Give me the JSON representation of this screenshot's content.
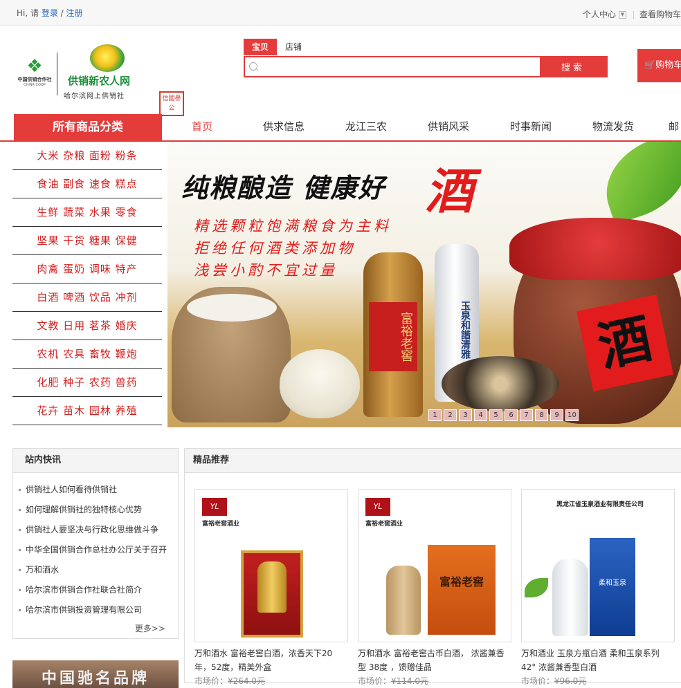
{
  "topbar": {
    "greeting": "Hi, 请",
    "login": "登录",
    "slash": "/",
    "register": "注册",
    "account": "个人中心",
    "view_cart": "查看购物车"
  },
  "logo": {
    "coop_cn": "中国供销合作社",
    "coop_en": "CHINA COOP",
    "brand": "供销新农人网",
    "brand_sub": "哈尔滨网上供销社",
    "stamp": "信國譽公"
  },
  "search": {
    "tab_active": "宝贝",
    "tab_other": "店铺",
    "placeholder": "",
    "button": "搜索"
  },
  "cart": {
    "label": "购物车"
  },
  "nav": {
    "all_categories": "所有商品分类",
    "items": [
      "首页",
      "供求信息",
      "龙江三农",
      "供销风采",
      "时事新闻",
      "物流发货",
      "邮"
    ]
  },
  "categories": [
    "大米 杂粮 面粉 粉条",
    "食油 副食 速食 糕点",
    "生鲜 蔬菜 水果 零食",
    "坚果 干货 糖果 保健",
    "肉禽 蛋奶 调味 特产",
    "白酒 啤酒 饮品 冲剂",
    "文教 日用 茗茶 婚庆",
    "农机 农具 畜牧 鞭炮",
    "化肥 种子 农药 兽药",
    "花卉 苗木 园林 养殖"
  ],
  "banner": {
    "headline": "纯粮酿造 健康好",
    "headline_big": "酒",
    "line1": "精选颗粒饱满粮食为主料",
    "line2": "拒绝任何酒类添加物",
    "line3": "浅尝小酌不宜过量",
    "bottle1_label": "富裕老窖",
    "bottle2_label": "玉泉和諧清雅",
    "jar_label": "酒",
    "pages": [
      "1",
      "2",
      "3",
      "4",
      "5",
      "6",
      "7",
      "8",
      "9",
      "10"
    ]
  },
  "news": {
    "title": "站内快讯",
    "items": [
      "供销社人如何看待供销社",
      "如何理解供销社的独特核心优势",
      "供销社人要坚决与行政化思维做斗争",
      "中华全国供销合作总社办公厅关于召开",
      "万和酒水",
      "哈尔滨市供销合作社联合社简介",
      "哈尔滨市供销投资管理有限公司"
    ],
    "more": "更多>>"
  },
  "ad": {
    "text": "中国驰名品牌"
  },
  "featured": {
    "title": "精品推荐",
    "products": [
      {
        "logo": "YL",
        "company": "富裕老窖酒业",
        "name": "万和酒水 富裕老窖白酒，浓香天下20年，52度，精美外盒",
        "price_label": "市场价：",
        "price": "¥264.0元"
      },
      {
        "logo": "YL",
        "company": "富裕老窖酒业",
        "box_text": "富裕老窖",
        "name": "万和酒水 富裕老窖古币白酒， 浓酱兼香型 38度 ，馈赠佳品",
        "price_label": "市场价：",
        "price": "¥114.0元"
      },
      {
        "company": "黑龙江省玉泉酒业有限责任公司",
        "box_text": "柔和玉泉",
        "name": "万和酒业 玉泉方瓶白酒 柔和玉泉系列 42° 浓酱兼香型白酒",
        "price_label": "市场价：",
        "price": "¥96.0元"
      }
    ]
  }
}
